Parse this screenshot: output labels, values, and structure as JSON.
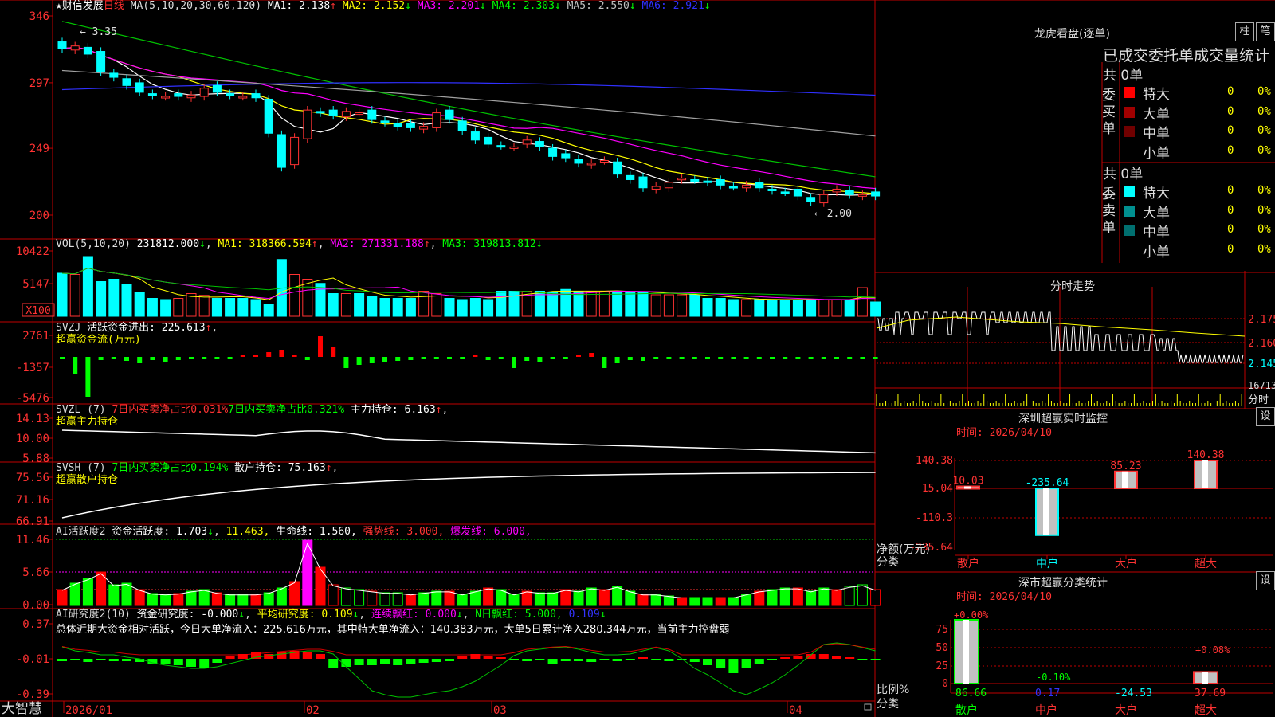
{
  "stock": {
    "star": "★",
    "name": "财信发展",
    "period": "日线",
    "ma_spec": "MA(5,10,20,30,60,120)"
  },
  "ma": [
    {
      "label": "MA1:",
      "value": "2.138",
      "arrow": "↑",
      "color": "#ffffff"
    },
    {
      "label": "MA2:",
      "value": "2.152",
      "arrow": "↓",
      "color": "#ffff00"
    },
    {
      "label": "MA3:",
      "value": "2.201",
      "arrow": "↓",
      "color": "#ff00ff"
    },
    {
      "label": "MA4:",
      "value": "2.303",
      "arrow": "↓",
      "color": "#00ff00"
    },
    {
      "label": "MA5:",
      "value": "2.550",
      "arrow": "↓",
      "color": "#c0c0c0"
    },
    {
      "label": "MA6:",
      "value": "2.921",
      "arrow": "↓",
      "color": "#3030ff"
    }
  ],
  "price_axis": [
    "346",
    "297",
    "249",
    "200"
  ],
  "annotations": {
    "high": "3.35",
    "low": "2.00"
  },
  "vol": {
    "title": "VOL(5,10,20)",
    "value": "231812.000",
    "arrow": "↓",
    "ma1": "MA1: 318366.594",
    "ma1_arrow": "↑",
    "ma2": "MA2: 271331.188",
    "ma2_arrow": "↑",
    "ma3": "MA3: 319813.812",
    "ma3_arrow": "↓",
    "axis": [
      "10422",
      "5147"
    ],
    "unit": "X100"
  },
  "svzj": {
    "title": "SVZJ",
    "line1": "活跃资金进出: 225.613",
    "arrow": "↑",
    "line2": "超赢资金流(万元)",
    "axis": [
      "2761",
      "-1357",
      "-5476"
    ]
  },
  "svzl": {
    "title": "SVZL (7)",
    "a": "7日内买卖净占比0.031%",
    "b": "7日内买卖净占比0.321%",
    "c": "主力持仓: 6.163",
    "arrow": "↑",
    "tail": ",",
    "line2": "超赢主力持仓",
    "axis": [
      "14.13",
      "10.00",
      "5.88"
    ]
  },
  "svsh": {
    "title": "SVSH (7)",
    "a": "7日内买卖净占比0.194%",
    "c": "散户持仓: 75.163",
    "arrow": "↑",
    "tail": ",",
    "line2": "超赢散户持仓",
    "axis": [
      "75.56",
      "71.16",
      "66.91"
    ]
  },
  "ai_act": {
    "title": "AI活跃度2",
    "a": "资金活跃度: 1.703",
    "a_arrow": "↓",
    "b": "11.463,",
    "c": "生命线: 1.560,",
    "d": "强势线: 3.000,",
    "e": "爆发线: 6.000,",
    "axis": [
      "11.46",
      "5.66",
      "0.00"
    ]
  },
  "ai_res": {
    "title": "AI研究度2(10)",
    "a": "资金研究度: -0.000",
    "a_arrow": "↓",
    "b": "平均研究度: 0.109",
    "b_arrow": "↓",
    "c": "连续飘红: 0.000",
    "c_arrow": "↓",
    "d": "N日飘红: 5.000,",
    "e": "0.109",
    "e_arrow": "↓",
    "summary": "总体近期大资金相对活跃，今日大单净流入：225.616万元，其中特大单净流入：140.383万元，大单5日累计净入280.344万元，当前主力控盘弱",
    "axis": [
      "0.37",
      "-0.01",
      "-0.39"
    ]
  },
  "time_axis": [
    "2026/01",
    "02",
    "03",
    "04"
  ],
  "brand": "大智慧",
  "right": {
    "lhb_title": "龙虎看盘(逐单)",
    "btn_bar": "柱",
    "btn_pen": "笔",
    "stat_title": "已成交委托单成交量统计",
    "buy_label": "委买单",
    "sell_label": "委卖单",
    "buy_total": "共 0单",
    "sell_total": "共 0单",
    "buy_rows": [
      {
        "name": "特大",
        "count": "0",
        "pct": "0%",
        "color": "#ff0000"
      },
      {
        "name": "大单",
        "count": "0",
        "pct": "0%",
        "color": "#a00000"
      },
      {
        "name": "中单",
        "count": "0",
        "pct": "0%",
        "color": "#700000"
      },
      {
        "name": "小单",
        "count": "0",
        "pct": "0%",
        "color": "#000000"
      }
    ],
    "sell_rows": [
      {
        "name": "特大",
        "count": "0",
        "pct": "0%",
        "color": "#00ffff"
      },
      {
        "name": "大单",
        "count": "0",
        "pct": "0%",
        "color": "#009090"
      },
      {
        "name": "中单",
        "count": "0",
        "pct": "0%",
        "color": "#007070"
      },
      {
        "name": "小单",
        "count": "0",
        "pct": "0%",
        "color": "#000000"
      }
    ],
    "intraday_title": "分时走势",
    "intraday_axis": [
      "2.175",
      "2.160",
      "2.145"
    ],
    "intraday_vol": "16713",
    "intraday_label": "分时",
    "sz_title": "深圳超赢实时监控",
    "sz_time": "时间: 2026/04/10",
    "set_btn": "设",
    "sz_axis": [
      "140.38",
      "15.04",
      "-110.3",
      "-235.64"
    ],
    "sz_ylabel": "净额(万元)",
    "sz_xlabel": "分类",
    "sz_bars": [
      {
        "cat": "散户",
        "value": "10.03"
      },
      {
        "cat": "中户",
        "value": "-235.64"
      },
      {
        "cat": "大户",
        "value": "85.23"
      },
      {
        "cat": "超大",
        "value": "140.38"
      }
    ],
    "cls_title": "深市超赢分类统计",
    "cls_time": "时间: 2026/04/10",
    "cls_axis": [
      "75",
      "50",
      "25",
      "0"
    ],
    "cls_ylabel": "比例%",
    "cls_xlabel": "分类",
    "cls_top": [
      "+0.00%",
      "-0.10%",
      "+0.08%"
    ],
    "cls_vals": [
      {
        "cat": "散户",
        "value": "86.66"
      },
      {
        "cat": "中户",
        "value": "0.17"
      },
      {
        "cat": "大户",
        "value": "-24.53"
      },
      {
        "cat": "超大",
        "value": "37.69"
      }
    ]
  },
  "chart_data": {
    "type": "candlestick",
    "n": 64,
    "ylim": [
      2.0,
      3.46
    ],
    "close": [
      3.22,
      3.24,
      3.18,
      3.05,
      3.01,
      2.95,
      2.9,
      2.88,
      2.87,
      2.87,
      2.88,
      2.93,
      2.9,
      2.88,
      2.87,
      2.86,
      2.6,
      2.35,
      2.57,
      2.77,
      2.75,
      2.73,
      2.76,
      2.75,
      2.7,
      2.68,
      2.65,
      2.64,
      2.65,
      2.75,
      2.7,
      2.62,
      2.55,
      2.52,
      2.51,
      2.5,
      2.55,
      2.5,
      2.43,
      2.42,
      2.38,
      2.38,
      2.4,
      2.3,
      2.26,
      2.2,
      2.21,
      2.24,
      2.27,
      2.26,
      2.24,
      2.22,
      2.21,
      2.22,
      2.2,
      2.18,
      2.17,
      2.14,
      2.1,
      2.15,
      2.19,
      2.15,
      2.15,
      2.14
    ],
    "volume": [
      0.72,
      0.7,
      1.0,
      0.58,
      0.62,
      0.54,
      0.4,
      0.3,
      0.28,
      0.3,
      0.38,
      0.35,
      0.3,
      0.3,
      0.3,
      0.28,
      0.2,
      0.95,
      0.7,
      0.62,
      0.55,
      0.38,
      0.38,
      0.38,
      0.33,
      0.3,
      0.3,
      0.3,
      0.42,
      0.38,
      0.3,
      0.28,
      0.3,
      0.28,
      0.42,
      0.42,
      0.42,
      0.42,
      0.4,
      0.45,
      0.42,
      0.42,
      0.42,
      0.42,
      0.4,
      0.4,
      0.36,
      0.36,
      0.36,
      0.36,
      0.3,
      0.3,
      0.28,
      0.28,
      0.28,
      0.28,
      0.28,
      0.28,
      0.28,
      0.28,
      0.28,
      0.28,
      0.48,
      0.24
    ]
  }
}
